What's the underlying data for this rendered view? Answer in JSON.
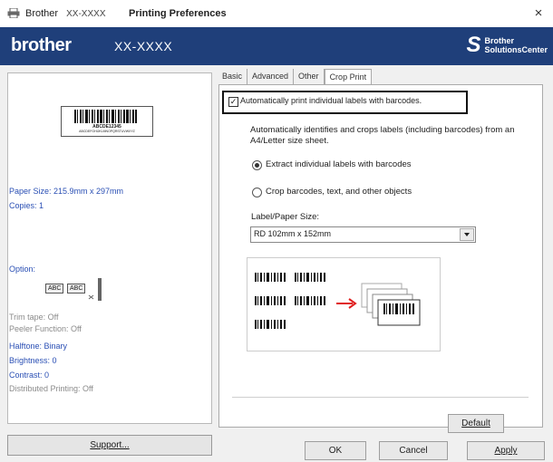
{
  "titlebar": {
    "app_name": "Brother",
    "model_masked": "XX-XXXX",
    "window_title": "Printing Preferences",
    "close_glyph": "×"
  },
  "brandbar": {
    "logo_text": "brother",
    "model": "XX-XXXX",
    "solutions_line1": "Brother",
    "solutions_line2": "SolutionsCenter",
    "bg_color": "#1f3f7a"
  },
  "preview": {
    "label_code": "ABCDE12345",
    "label_subtext": "ABCDEFGHIJKLMNOPQRSTUVWXYZ"
  },
  "left_panel": {
    "paper_size": "Paper Size: 215.9mm x 297mm",
    "copies": "Copies: 1",
    "option_title": "Option:",
    "option_icon_text_1": "ABC",
    "option_icon_text_2": "ABC",
    "trim_tape": "Trim tape: Off",
    "peeler_function": "Peeler Function: Off",
    "halftone": "Halftone: Binary",
    "brightness": "Brightness:  0",
    "contrast": "Contrast:  0",
    "distributed_printing": "Distributed Printing: Off",
    "support_button": "Support..."
  },
  "tabs": [
    "Basic",
    "Advanced",
    "Other",
    "Crop Print"
  ],
  "active_tab_index": 3,
  "crop_print": {
    "auto_checkbox_label": "Automatically print individual labels with barcodes.",
    "auto_checked": true,
    "description": "Automatically identifies and crops labels (including barcodes) from an A4/Letter size sheet.",
    "radio_extract": "Extract individual labels with barcodes",
    "radio_crop": "Crop barcodes, text, and other objects",
    "selected_radio": "extract",
    "size_label": "Label/Paper Size:",
    "size_value": "RD 102mm x 152mm"
  },
  "buttons": {
    "default": "Default",
    "ok": "OK",
    "cancel": "Cancel",
    "apply": "Apply"
  },
  "colors": {
    "accent_blue": "#2a4fb4",
    "arrow_red": "#e02020"
  }
}
